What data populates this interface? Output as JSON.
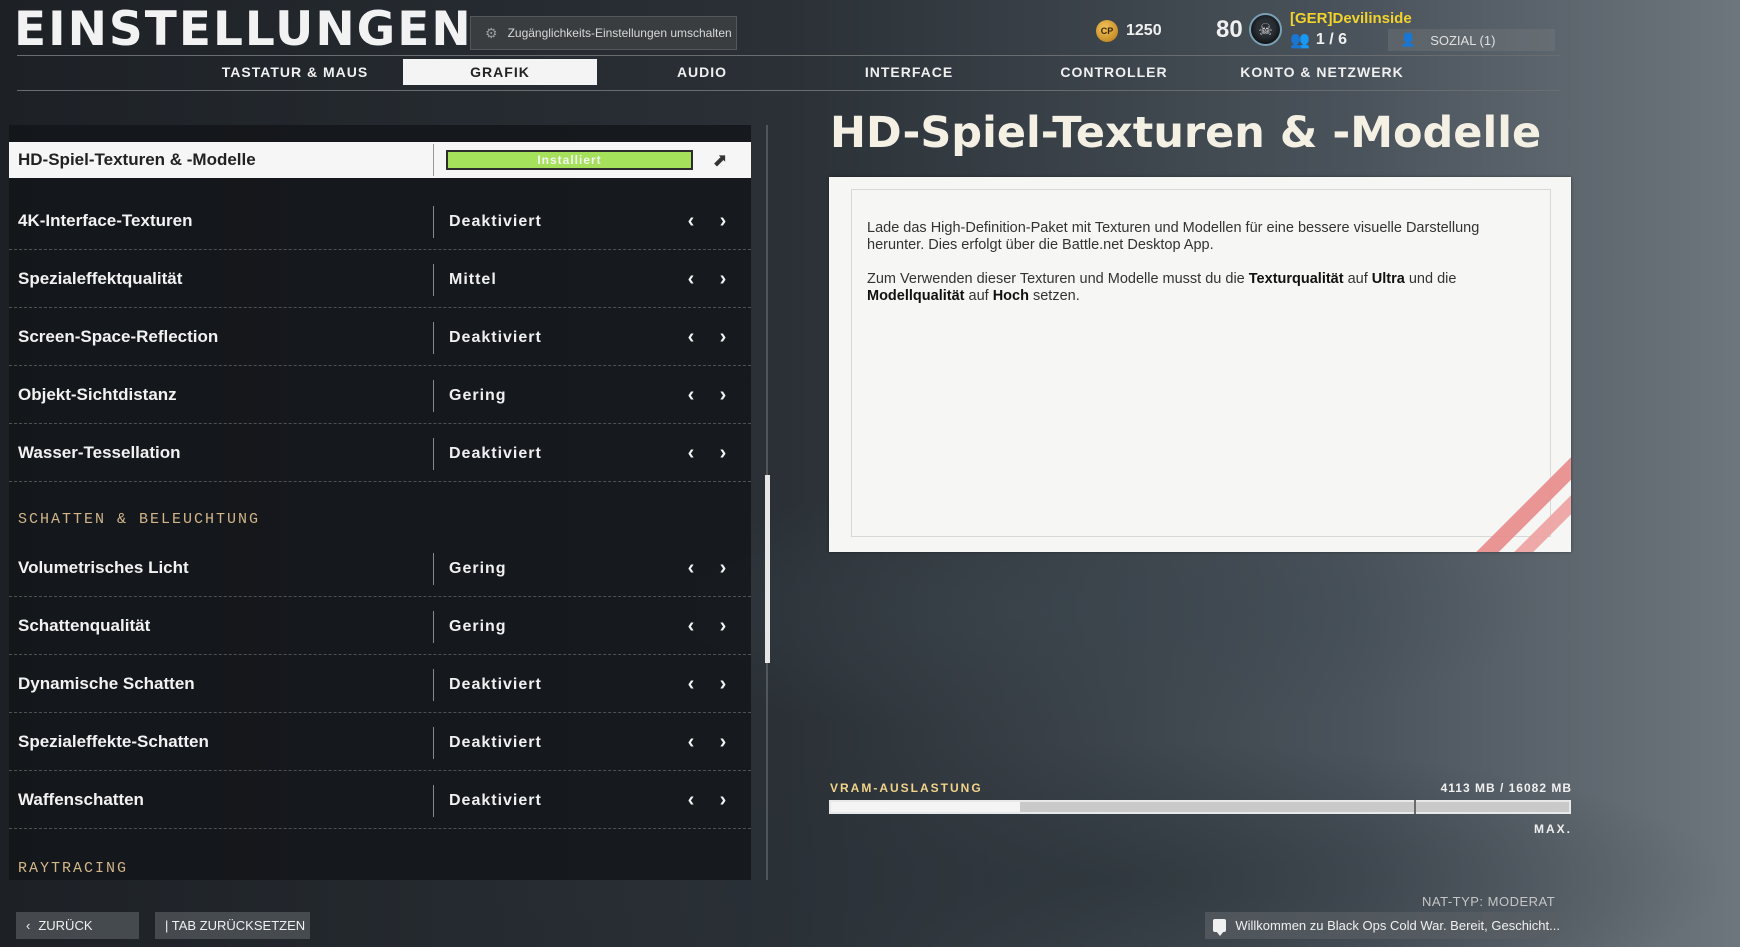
{
  "header": {
    "title": "EINSTELLUNGEN",
    "accessibility_toggle": "Zugänglichkeits-Einstellungen umschalten",
    "accessibility_icon": "gear-icon",
    "cod_points_icon_text": "CP",
    "cod_points": "1250",
    "level": "80",
    "player_name": "[GER]Devilinside",
    "party_count": "1 / 6",
    "party_icon": "users-icon",
    "social_label": "SOZIAL (1)",
    "social_icon": "person-icon"
  },
  "tabs": [
    {
      "label": "TASTATUR & MAUS",
      "active": false
    },
    {
      "label": "GRAFIK",
      "active": true
    },
    {
      "label": "AUDIO",
      "active": false
    },
    {
      "label": "INTERFACE",
      "active": false
    },
    {
      "label": "CONTROLLER",
      "active": false
    },
    {
      "label": "KONTO & NETZWERK",
      "active": false
    }
  ],
  "settings": {
    "hd_row": {
      "label": "HD-Spiel-Texturen & -Modelle",
      "value": "Installiert",
      "icon": "external-link-icon"
    },
    "rows": [
      {
        "label": "4K-Interface-Texturen",
        "value": "Deaktiviert"
      },
      {
        "label": "Spezialeffektqualität",
        "value": "Mittel"
      },
      {
        "label": "Screen-Space-Reflection",
        "value": "Deaktiviert"
      },
      {
        "label": "Objekt-Sichtdistanz",
        "value": "Gering"
      },
      {
        "label": "Wasser-Tessellation",
        "value": "Deaktiviert"
      }
    ],
    "shadow_section": "SCHATTEN & BELEUCHTUNG",
    "shadow_rows": [
      {
        "label": "Volumetrisches Licht",
        "value": "Gering"
      },
      {
        "label": "Schattenqualität",
        "value": "Gering"
      },
      {
        "label": "Dynamische Schatten",
        "value": "Deaktiviert"
      },
      {
        "label": "Spezialeffekte-Schatten",
        "value": "Deaktiviert"
      },
      {
        "label": "Waffenschatten",
        "value": "Deaktiviert"
      }
    ],
    "raytracing_section": "RAYTRACING",
    "arrow_left": "‹",
    "arrow_right": "›"
  },
  "detail": {
    "title": "HD-Spiel-Texturen & -Modelle",
    "paragraph1": "Lade das High-Definition-Paket mit Texturen und Modellen für eine bessere visuelle Darstellung herunter. Dies erfolgt über die Battle.net Desktop App.",
    "p2_a": "Zum Verwenden dieser Texturen und Modelle musst du die ",
    "p2_b": "Texturqualität",
    "p2_c": " auf ",
    "p2_d": "Ultra",
    "p2_e": " und die ",
    "p2_f": "Modellqualität",
    "p2_g": " auf ",
    "p2_h": "Hoch",
    "p2_i": " setzen."
  },
  "vram": {
    "label": "VRAM-AUSLASTUNG",
    "value": "4113 MB / 16082 MB",
    "used_fraction": 0.256,
    "max_fraction": 0.79,
    "max_label": "MAX."
  },
  "footer": {
    "nat_type": "NAT-TYP: MODERAT",
    "back_label": "ZURÜCK",
    "back_icon": "chevron-left-icon",
    "reset_label": "| TAB ZURÜCKSETZEN",
    "chat_icon": "chat-bubble-icon",
    "chat_message": "Willkommen zu Black Ops Cold War. Bereit, Geschicht..."
  }
}
